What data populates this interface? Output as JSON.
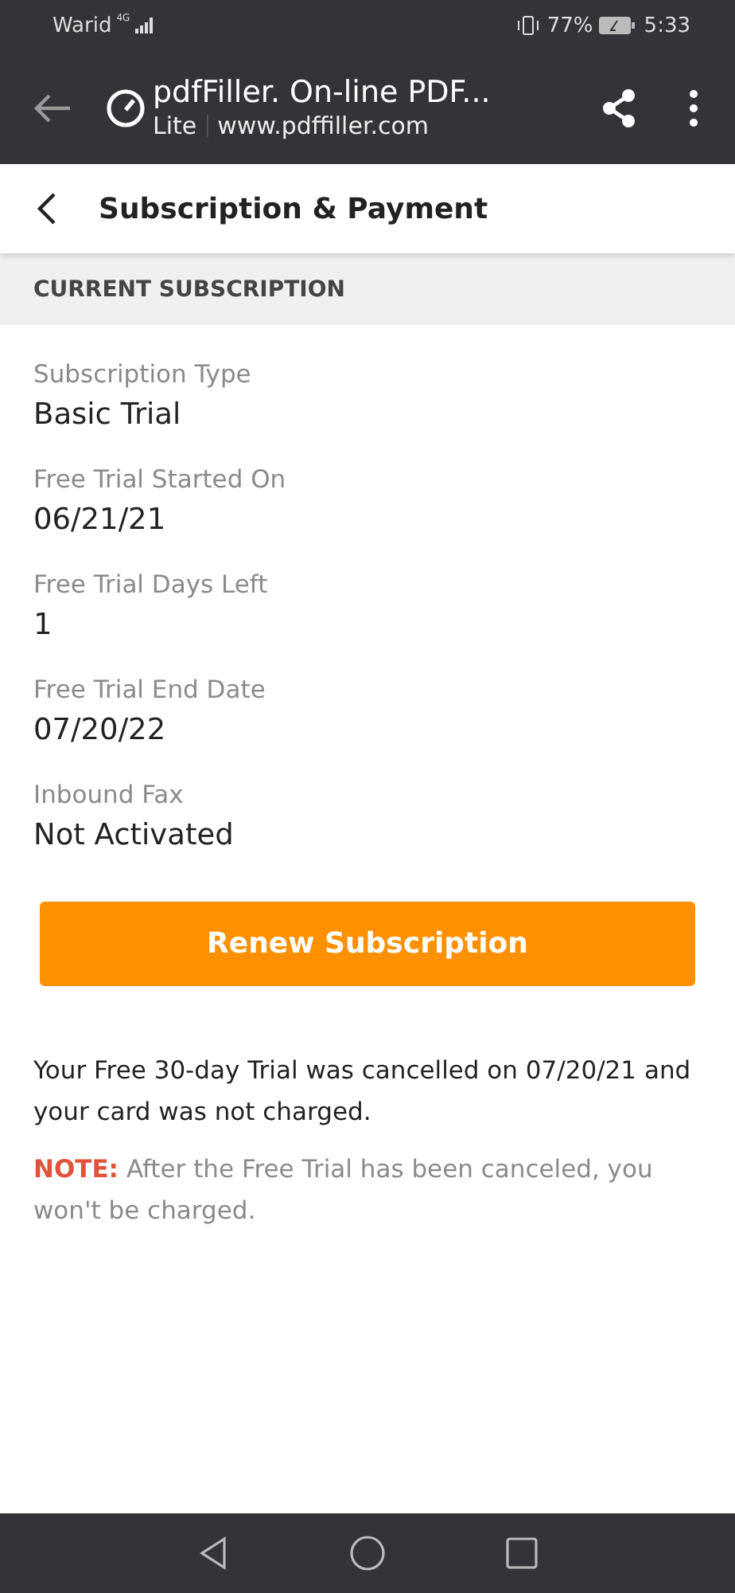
{
  "status_bar": {
    "carrier": "Warid",
    "network": "4G",
    "battery": "77%",
    "time": "5:33"
  },
  "browser_bar": {
    "title": "pdfFiller. On-line PDF...",
    "badge": "Lite",
    "url": "www.pdffiller.com"
  },
  "header": {
    "title": "Subscription & Payment"
  },
  "section": {
    "title": "CURRENT SUBSCRIPTION"
  },
  "fields": [
    {
      "label": "Subscription Type",
      "value": "Basic Trial"
    },
    {
      "label": "Free Trial Started On",
      "value": "06/21/21"
    },
    {
      "label": "Free Trial Days Left",
      "value": "1"
    },
    {
      "label": "Free Trial End Date",
      "value": "07/20/22"
    },
    {
      "label": "Inbound Fax",
      "value": "Not Activated"
    }
  ],
  "renew_button": "Renew Subscription",
  "message": "Your Free 30-day Trial was cancelled on 07/20/21 and your card was not charged.",
  "note": "**NOTE:** After the Free Trial has been canceled, you won't be charged."
}
